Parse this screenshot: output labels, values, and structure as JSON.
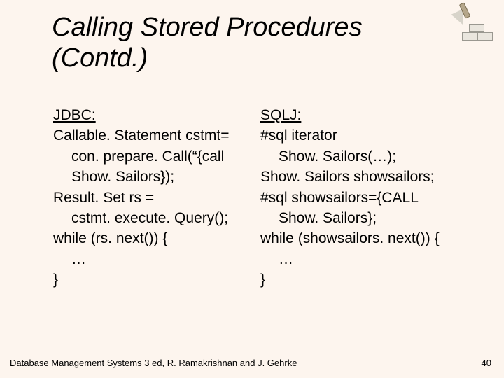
{
  "title_line1": "Calling Stored Procedures",
  "title_line2": "(Contd.)",
  "left": {
    "heading": "JDBC:",
    "l1": "Callable. Statement cstmt=",
    "l2": "con. prepare. Call(“{call",
    "l3": "Show. Sailors});",
    "l4": "Result. Set rs =",
    "l5": "cstmt. execute. Query();",
    "l6": "while (rs. next()) {",
    "l7": "…",
    "l8": "}"
  },
  "right": {
    "heading": "SQLJ:",
    "l1": "#sql iterator",
    "l2": "Show. Sailors(…);",
    "l3": "Show. Sailors showsailors;",
    "l4": "#sql showsailors={CALL",
    "l5": "Show. Sailors};",
    "l6": "while (showsailors. next()) {",
    "l7": "…",
    "l8": "}"
  },
  "footer": "Database Management Systems 3 ed,  R. Ramakrishnan and J. Gehrke",
  "pagenum": "40"
}
